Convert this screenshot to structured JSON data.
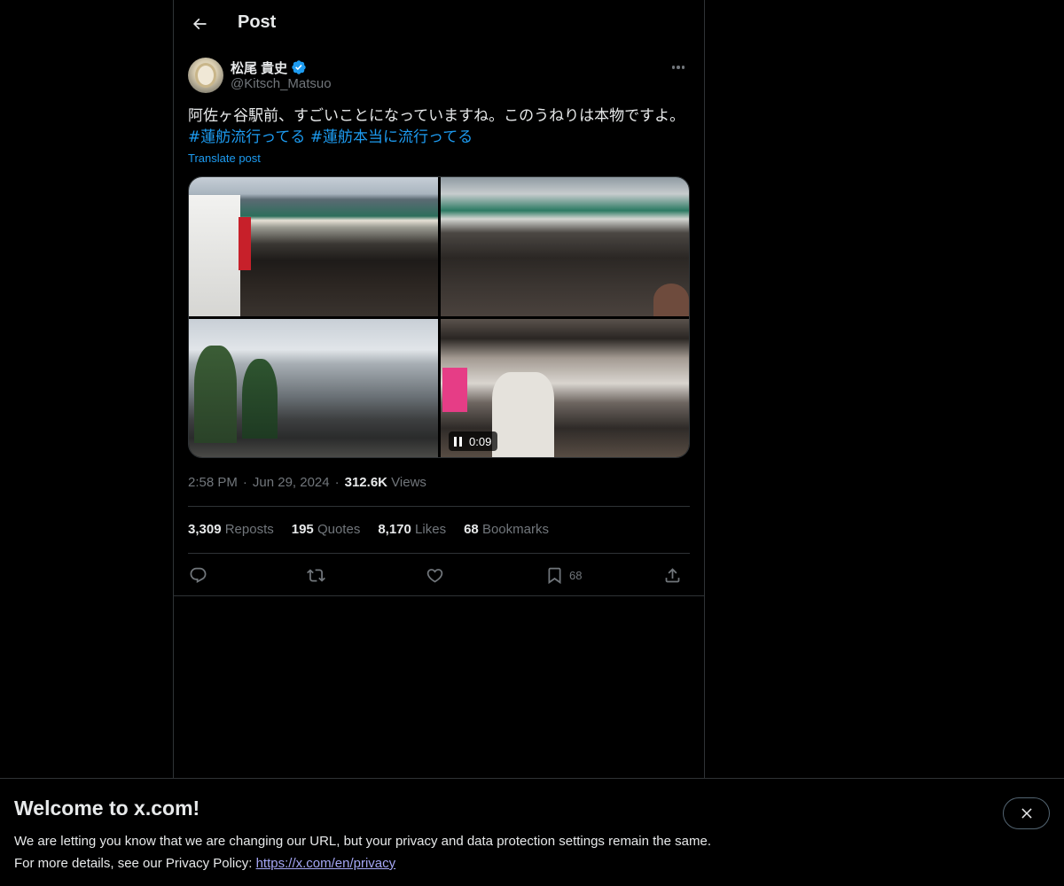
{
  "header": {
    "title": "Post",
    "back_icon": "arrow-left-icon"
  },
  "author": {
    "display_name": "松尾 貴史",
    "handle": "@Kitsch_Matsuo",
    "verified": true,
    "verified_color": "#1d9bf0"
  },
  "post": {
    "text": "阿佐ヶ谷駅前、すごいことになっていますね。このうねりは本物ですよ。",
    "hashtags": [
      "#蓮舫流行ってる",
      "#蓮舫本当に流行ってる"
    ],
    "translate_label": "Translate post",
    "video_time": "0:09"
  },
  "meta": {
    "time": "2:58 PM",
    "date": "Jun 29, 2024",
    "views_count": "312.6K",
    "views_label": "Views"
  },
  "stats": {
    "reposts_count": "3,309",
    "reposts_label": "Reposts",
    "quotes_count": "195",
    "quotes_label": "Quotes",
    "likes_count": "8,170",
    "likes_label": "Likes",
    "bookmarks_count": "68",
    "bookmarks_label": "Bookmarks"
  },
  "actions": {
    "bookmark_count": "68",
    "icons": [
      "reply-icon",
      "repost-icon",
      "like-icon",
      "bookmark-icon",
      "share-icon"
    ]
  },
  "banner": {
    "title": "Welcome to x.com!",
    "line1": "We are letting you know that we are changing our URL, but your privacy and data protection settings remain the same.",
    "line2_prefix": "For more details, see our Privacy Policy: ",
    "link": "https://x.com/en/privacy"
  },
  "colors": {
    "background": "#000000",
    "accent": "#1d9bf0",
    "muted": "#71767b",
    "border": "#2f3336",
    "link_banner": "#a5a7f5"
  }
}
